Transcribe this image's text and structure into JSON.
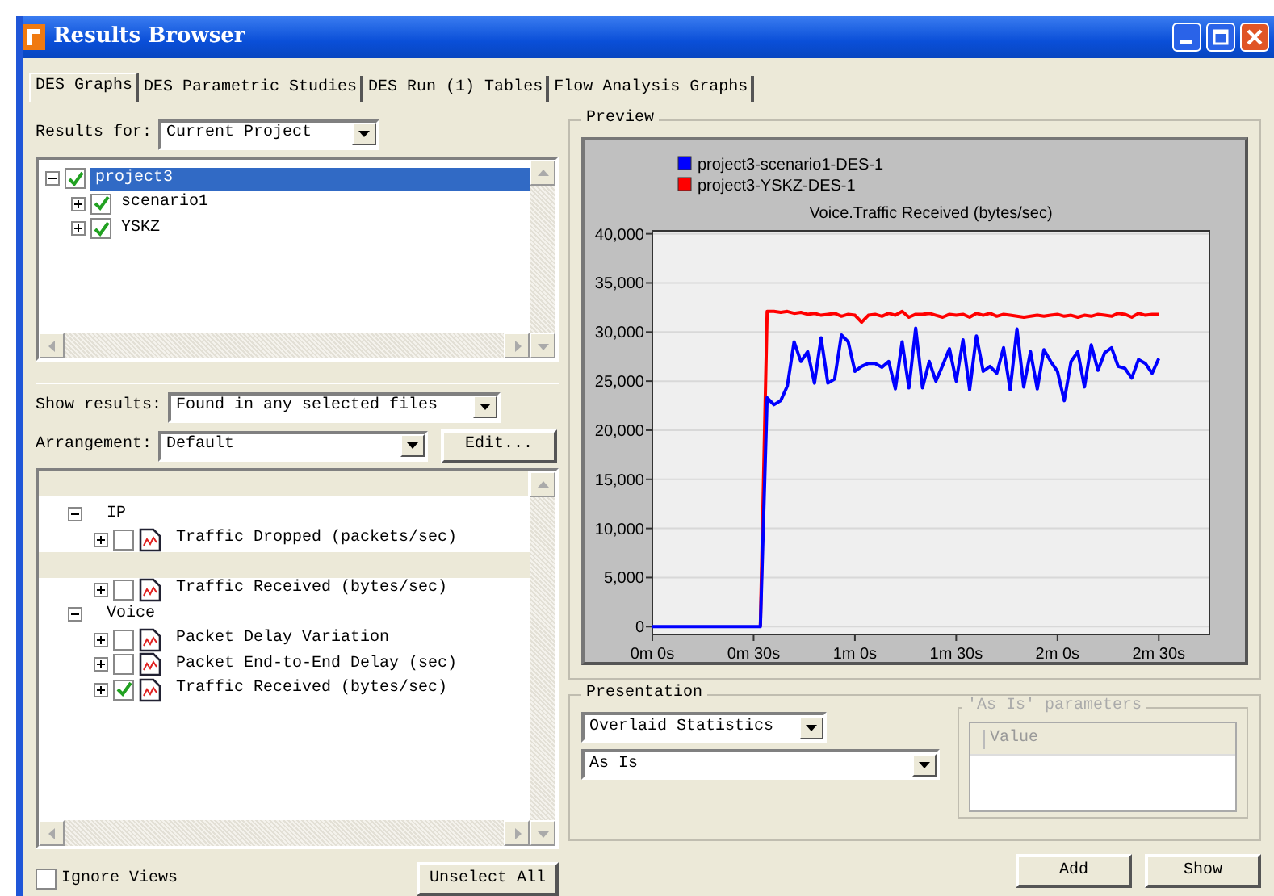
{
  "window": {
    "title": "Results Browser"
  },
  "tabs": [
    {
      "label": "DES Graphs",
      "selected": true
    },
    {
      "label": "DES Parametric Studies",
      "selected": false
    },
    {
      "label": "DES Run (1) Tables",
      "selected": false
    },
    {
      "label": "Flow Analysis Graphs",
      "selected": false
    }
  ],
  "results_for": {
    "label": "Results for:",
    "value": "Current Project"
  },
  "results_tree": [
    {
      "label": "project3",
      "checked": true,
      "expanded": true,
      "selected": true,
      "children": [
        {
          "label": "scenario1",
          "checked": true,
          "expanded": false,
          "selected": false
        },
        {
          "label": "YSKZ",
          "checked": true,
          "expanded": false,
          "selected": false
        }
      ]
    }
  ],
  "show_results": {
    "label": "Show results:",
    "value": "Found in any selected files"
  },
  "arrangement": {
    "label": "Arrangement:",
    "value": "Default",
    "button": "Edit..."
  },
  "statistics_tree": [
    {
      "kind": "group",
      "label": "IP",
      "expanded": true,
      "children": [
        {
          "kind": "statistic",
          "label": "Traffic Dropped (packets/sec)",
          "checked": false,
          "expanded": false
        },
        {
          "kind": "blank"
        },
        {
          "kind": "statistic",
          "label": "Traffic Received (bytes/sec)",
          "checked": false,
          "expanded": false
        }
      ]
    },
    {
      "kind": "group",
      "label": "Voice",
      "expanded": true,
      "children": [
        {
          "kind": "statistic",
          "label": "Packet Delay Variation",
          "checked": false,
          "expanded": false
        },
        {
          "kind": "statistic",
          "label": "Packet End-to-End Delay (sec)",
          "checked": false,
          "expanded": false
        },
        {
          "kind": "statistic",
          "label": "Traffic Received (bytes/sec)",
          "checked": true,
          "expanded": false
        }
      ]
    }
  ],
  "ignore_views": {
    "label": "Ignore Views",
    "checked": false
  },
  "unselect_all_button": "Unselect All",
  "preview": {
    "title": "Preview",
    "chart_data": {
      "type": "line",
      "title": "Voice.Traffic Received (bytes/sec)",
      "categories": [
        "0m 0s",
        null,
        null,
        null,
        null,
        null,
        null,
        null,
        null,
        null,
        null,
        null,
        null,
        null,
        null,
        "0m 30s",
        null,
        null,
        null,
        null,
        null,
        null,
        null,
        null,
        null,
        null,
        null,
        null,
        null,
        null,
        "1m 0s",
        null,
        null,
        null,
        null,
        null,
        null,
        null,
        null,
        null,
        null,
        null,
        null,
        null,
        null,
        "1m 30s",
        null,
        null,
        null,
        null,
        null,
        null,
        null,
        null,
        null,
        null,
        null,
        null,
        null,
        null,
        "2m 0s",
        null,
        null,
        null,
        null,
        null,
        null,
        null,
        null,
        null,
        null,
        null,
        null,
        null,
        null,
        "2m 30s"
      ],
      "series": [
        {
          "name": "project3-scenario1-DES-1",
          "color": "#0000ff",
          "values": [
            0,
            0,
            0,
            0,
            0,
            0,
            0,
            0,
            0,
            0,
            0,
            0,
            0,
            0,
            0,
            0,
            0,
            23300,
            22600,
            23000,
            24500,
            29000,
            27000,
            28000,
            24800,
            29400,
            24800,
            25200,
            29700,
            29000,
            26000,
            26500,
            26800,
            26800,
            26400,
            27000,
            24200,
            29000,
            24300,
            30400,
            24300,
            27000,
            25000,
            26600,
            28300,
            25000,
            29200,
            24100,
            29600,
            26000,
            26500,
            25800,
            28400,
            24100,
            30300,
            24400,
            28000,
            24200,
            28200,
            27000,
            26000,
            23000,
            27000,
            28000,
            24400,
            28700,
            26100,
            27900,
            28400,
            26500,
            26300,
            25300,
            27200,
            26800,
            25800,
            27300
          ]
        },
        {
          "name": "project3-YSKZ-DES-1",
          "color": "#ff0000",
          "values": [
            null,
            null,
            null,
            null,
            null,
            null,
            null,
            null,
            null,
            null,
            null,
            null,
            null,
            null,
            null,
            null,
            0,
            32100,
            32100,
            32000,
            32100,
            31900,
            32000,
            31800,
            31900,
            31700,
            31800,
            31900,
            31600,
            31800,
            31700,
            31000,
            31700,
            31800,
            31600,
            31900,
            31700,
            32100,
            31500,
            31800,
            31800,
            31900,
            31700,
            31500,
            31800,
            31700,
            31800,
            31500,
            31900,
            31700,
            31900,
            31600,
            31800,
            31700,
            31600,
            31500,
            31600,
            31700,
            31600,
            31700,
            31800,
            31600,
            31700,
            31500,
            31700,
            31600,
            31800,
            31700,
            31600,
            31900,
            31800,
            31500,
            31900,
            31700,
            31800,
            31800
          ]
        }
      ],
      "grid": true,
      "legend": "top-left",
      "ylim": [
        -800,
        40300
      ],
      "yticks": [
        {
          "value": 0,
          "label": "0"
        },
        {
          "value": 5000,
          "label": "5,000"
        },
        {
          "value": 10000,
          "label": "10,000"
        },
        {
          "value": 15000,
          "label": "15,000"
        },
        {
          "value": 20000,
          "label": "20,000"
        },
        {
          "value": 25000,
          "label": "25,000"
        },
        {
          "value": 30000,
          "label": "30,000"
        },
        {
          "value": 35000,
          "label": "35,000"
        },
        {
          "value": 40000,
          "label": "40,000"
        }
      ]
    }
  },
  "presentation": {
    "title": "Presentation",
    "mode": "Overlaid Statistics",
    "filter": "As Is",
    "parameters": {
      "title": "'As Is' parameters",
      "columns": [
        "Value"
      ],
      "disabled": true
    }
  },
  "buttons": [
    "Add",
    "Show"
  ]
}
